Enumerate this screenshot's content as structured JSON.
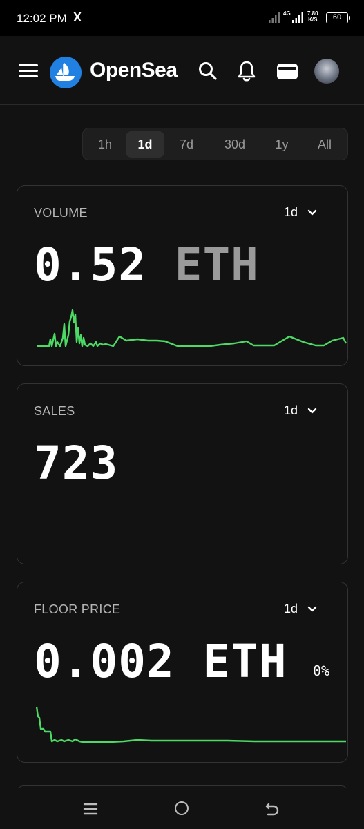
{
  "status_bar": {
    "time": "12:02 PM",
    "x_icon": "X",
    "network": "4G",
    "speed_value": "7.80",
    "speed_unit": "K/S",
    "battery": "60"
  },
  "header": {
    "brand": "OpenSea",
    "icons": [
      "menu-icon",
      "opensea-logo",
      "search-icon",
      "bell-icon",
      "wallet-icon",
      "avatar"
    ]
  },
  "time_range": {
    "options": [
      "1h",
      "1d",
      "7d",
      "30d",
      "1y",
      "All"
    ],
    "selected": "1d"
  },
  "cards": [
    {
      "label": "VOLUME",
      "range": "1d",
      "value": "0.52",
      "unit": "ETH",
      "accent": "#4CD964"
    },
    {
      "label": "SALES",
      "range": "1d",
      "value": "723"
    },
    {
      "label": "FLOOR PRICE",
      "range": "1d",
      "value": "0.002",
      "unit": "ETH",
      "change": "0%",
      "accent": "#4CD964"
    }
  ],
  "nav": {
    "icons": [
      "recents-icon",
      "home-icon",
      "back-icon"
    ]
  },
  "colors": {
    "background": "#121212",
    "card_border": "#333333",
    "accent_green": "#4CD964",
    "brand_blue": "#2081E2"
  }
}
